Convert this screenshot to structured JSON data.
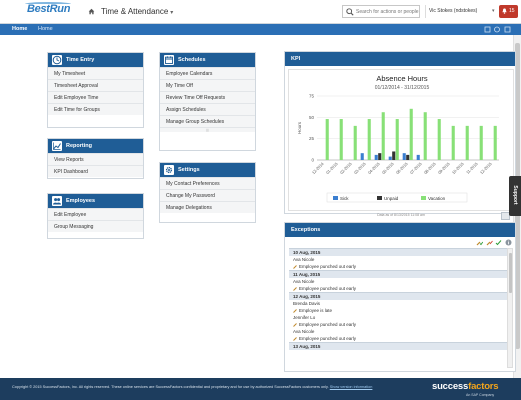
{
  "header": {
    "logo": "BestRun",
    "module": "Time & Attendance",
    "search_placeholder": "Search for actions or people",
    "user_name": "Vic Stokes (ndstokes)",
    "notification_count": "15"
  },
  "nav": {
    "tabs": [
      "Home",
      "Home"
    ]
  },
  "tiles": {
    "time_entry": {
      "title": "Time Entry",
      "items": [
        "My Timesheet",
        "Timesheet Approval",
        "Edit Employee Time",
        "Edit Time for Groups"
      ]
    },
    "reporting": {
      "title": "Reporting",
      "items": [
        "View Reports",
        "KPI Dashboard"
      ]
    },
    "employees": {
      "title": "Employees",
      "items": [
        "Edit Employee",
        "Group Messaging"
      ]
    },
    "schedules": {
      "title": "Schedules",
      "items": [
        "Employee Calendars",
        "My Time Off",
        "Review Time Off Requests",
        "Assign Schedules",
        "Manage Group Schedules"
      ]
    },
    "settings": {
      "title": "Settings",
      "items": [
        "My Contact Preferences",
        "Change My Password",
        "Manage Delegations"
      ]
    }
  },
  "kpi": {
    "title": "KPI",
    "footnote": "Data as of 8/13/2015 11:08 am"
  },
  "chart_data": {
    "type": "bar",
    "title": "Absence Hours",
    "subtitle": "01/12/2014 - 31/12/2015",
    "ylabel": "Hours",
    "ylim": [
      0,
      75
    ],
    "yticks": [
      0,
      25,
      50,
      75
    ],
    "categories": [
      "12-2014",
      "01-2015",
      "02-2015",
      "03-2015",
      "04-2015",
      "05-2015",
      "06-2015",
      "07-2015",
      "08-2015",
      "09-2015",
      "10-2015",
      "11-2015",
      "12-2015"
    ],
    "series": [
      {
        "name": "Sick",
        "color": "#3b7fd0",
        "values": [
          0,
          0,
          0,
          8,
          6,
          4,
          8,
          6,
          0,
          0,
          0,
          0,
          0
        ]
      },
      {
        "name": "Unpaid",
        "color": "#333333",
        "values": [
          0,
          0,
          0,
          0,
          8,
          10,
          6,
          0,
          0,
          0,
          0,
          0,
          0
        ]
      },
      {
        "name": "Vacation",
        "color": "#88e077",
        "values": [
          48,
          48,
          40,
          48,
          56,
          48,
          60,
          56,
          48,
          40,
          40,
          40,
          40
        ]
      }
    ],
    "legend": "bottom",
    "grid": true
  },
  "exceptions": {
    "title": "Exceptions",
    "groups": [
      {
        "date": "10 Aug, 2015",
        "entries": [
          {
            "name": "Ava Nicole",
            "events": [
              "Employee punched out early"
            ]
          }
        ]
      },
      {
        "date": "11 Aug, 2015",
        "entries": [
          {
            "name": "Ava Nicole",
            "events": [
              "Employee punched out early"
            ]
          }
        ]
      },
      {
        "date": "12 Aug, 2015",
        "entries": [
          {
            "name": "Brenda Davis",
            "events": [
              "Employee is late"
            ]
          },
          {
            "name": "Jennifer Lo",
            "events": [
              "Employee punched out early"
            ]
          },
          {
            "name": "Ava Nicole",
            "events": [
              "Employee punched out early"
            ]
          }
        ]
      },
      {
        "date": "13 Aug, 2015",
        "entries": []
      }
    ]
  },
  "footer": {
    "copyright": "Copyright © 2015 SuccessFactors, Inc. All rights reserved. These online services are SuccessFactors confidential and proprietary and for use by authorized SuccessFactors customers only.",
    "link": "Show version information",
    "brand_a": "success",
    "brand_b": "factors",
    "brand_sub": "An SAP Company"
  }
}
